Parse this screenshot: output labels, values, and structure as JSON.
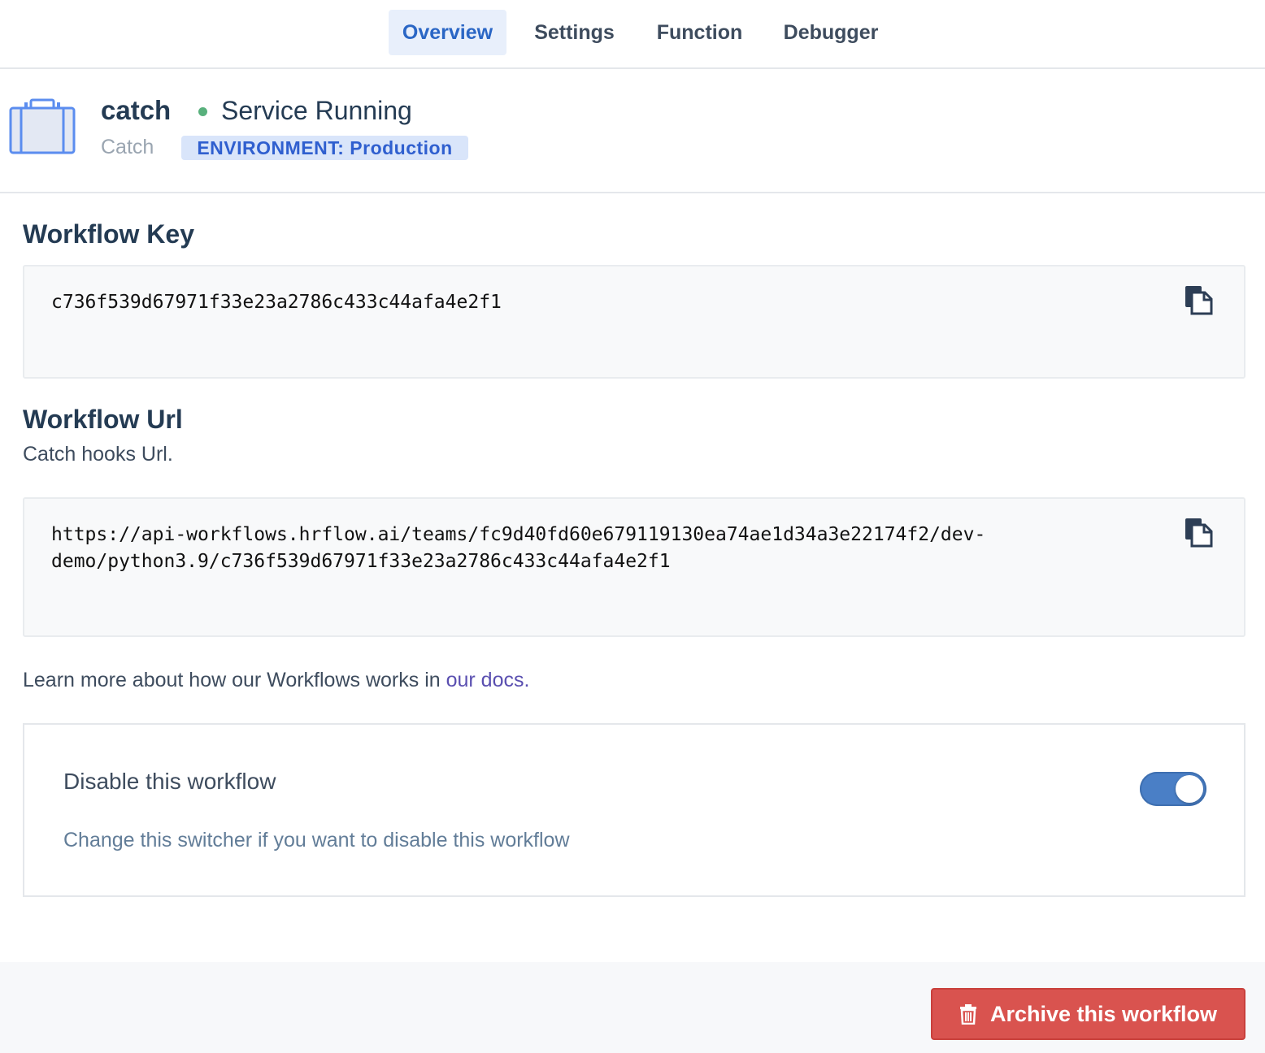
{
  "tabs": [
    {
      "label": "Overview",
      "active": true
    },
    {
      "label": "Settings",
      "active": false
    },
    {
      "label": "Function",
      "active": false
    },
    {
      "label": "Debugger",
      "active": false
    }
  ],
  "header": {
    "icon": "briefcase-icon",
    "workflow_name": "catch",
    "workflow_type": "Catch",
    "status": "Service Running",
    "status_color": "#58b07c",
    "environment_badge": "ENVIRONMENT: Production"
  },
  "workflow_key": {
    "title": "Workflow Key",
    "value": "c736f539d67971f33e23a2786c433c44afa4e2f1",
    "copy_icon": "copy-icon"
  },
  "workflow_url": {
    "title": "Workflow Url",
    "description": "Catch hooks Url.",
    "value_line1": "https://api-workflows.hrflow.ai/teams/fc9d40fd60e679119130ea74ae1d34a3e22174f2/dev-",
    "value_line2": "demo/python3.9/c736f539d67971f33e23a2786c433c44afa4e2f1",
    "copy_icon": "copy-icon"
  },
  "learn_more": {
    "text": "Learn more about how our Workflows works in ",
    "link_text": "our docs."
  },
  "disable_card": {
    "title": "Disable this workflow",
    "description": "Change this switcher if you want to disable this workflow",
    "toggle_on": true
  },
  "footer": {
    "archive_label": "Archive this workflow",
    "archive_icon": "trash-icon",
    "archive_color": "#d9534f"
  }
}
